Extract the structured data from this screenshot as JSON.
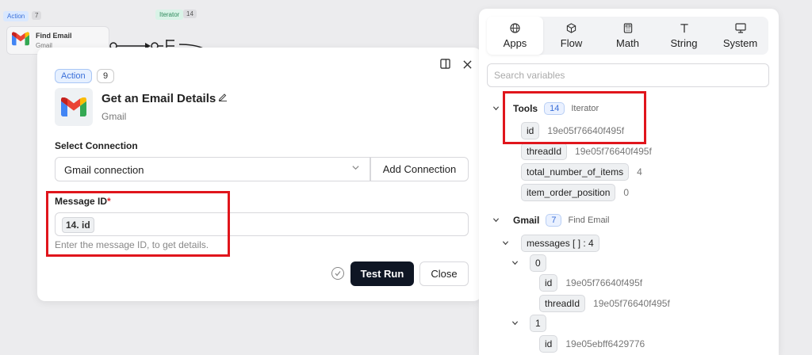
{
  "background": {
    "action_badge": "Action",
    "action_count": "7",
    "iterator_badge": "Iterator",
    "iterator_count": "14",
    "node_title": "Find Email",
    "node_subtitle": "Gmail"
  },
  "dialog": {
    "type_badge": "Action",
    "step_number": "9",
    "title": "Get an Email Details",
    "subtitle": "Gmail",
    "connection_label": "Select Connection",
    "connection_value": "Gmail connection",
    "add_connection_label": "Add Connection",
    "message_label": "Message ID",
    "required_mark": "*",
    "message_value": "14. id",
    "message_hint": "Enter the message ID, to get details.",
    "test_run_label": "Test Run",
    "close_label": "Close"
  },
  "panel": {
    "tabs": [
      {
        "label": "Apps",
        "icon": "globe-icon",
        "active": true
      },
      {
        "label": "Flow",
        "icon": "cube-icon",
        "active": false
      },
      {
        "label": "Math",
        "icon": "calculator-icon",
        "active": false
      },
      {
        "label": "String",
        "icon": "text-icon",
        "active": false
      },
      {
        "label": "System",
        "icon": "monitor-icon",
        "active": false
      }
    ],
    "search_placeholder": "Search variables",
    "groups": {
      "tools": {
        "name": "Tools",
        "count": "14",
        "type": "Iterator",
        "items": [
          {
            "key": "id",
            "value": "19e05f76640f495f"
          },
          {
            "key": "threadId",
            "value": "19e05f76640f495f"
          },
          {
            "key": "total_number_of_items",
            "value": "4"
          },
          {
            "key": "item_order_position",
            "value": "0"
          }
        ]
      },
      "gmail": {
        "name": "Gmail",
        "count": "7",
        "type": "Find Email",
        "messages_key": "messages [ ] : 4",
        "entries": [
          {
            "index": "0",
            "items": [
              {
                "key": "id",
                "value": "19e05f76640f495f"
              },
              {
                "key": "threadId",
                "value": "19e05f76640f495f"
              }
            ]
          },
          {
            "index": "1",
            "items": [
              {
                "key": "id",
                "value": "19e05ebff6429776"
              }
            ]
          }
        ]
      }
    }
  },
  "colors": {
    "highlight": "#e0151c",
    "accent_blue": "#3a6fd8",
    "primary_button": "#0f1624"
  }
}
